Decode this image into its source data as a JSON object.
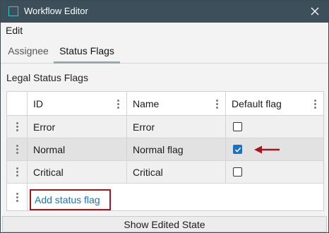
{
  "window": {
    "title": "Workflow Editor"
  },
  "menu": {
    "items": [
      "Edit"
    ]
  },
  "tabs": [
    {
      "label": "Assignee",
      "active": false
    },
    {
      "label": "Status Flags",
      "active": true
    }
  ],
  "section": {
    "title": "Legal Status Flags"
  },
  "grid": {
    "columns": [
      "ID",
      "Name",
      "Default flag"
    ],
    "rows": [
      {
        "id": "Error",
        "name": "Error",
        "default": false
      },
      {
        "id": "Normal",
        "name": "Normal flag",
        "default": true
      },
      {
        "id": "Critical",
        "name": "Critical",
        "default": false
      }
    ],
    "add_label": "Add status flag"
  },
  "footer": {
    "button_label": "Show Edited State"
  },
  "colors": {
    "titlebar": "#3d4f5b",
    "accent_link": "#1f73b7",
    "highlight_box": "#a3161f",
    "checkbox_checked": "#1b6fc4",
    "tab_underline": "#93aab3"
  },
  "icons": [
    "app-icon",
    "close-icon",
    "kebab-icon",
    "checkmark-icon",
    "arrow-left-icon"
  ]
}
